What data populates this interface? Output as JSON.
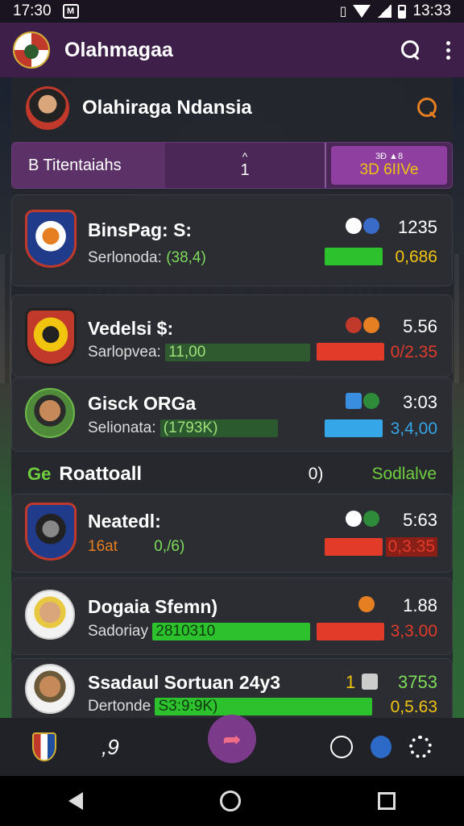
{
  "status": {
    "time_left": "17:30",
    "app_icon": "M",
    "time_right": "13:33"
  },
  "appbar": {
    "title": "Olahmagaa"
  },
  "org": {
    "name": "Olahiraga Ndansia"
  },
  "tabs": {
    "tab1": "B Titentaiahs",
    "tab2_caret": "^",
    "tab2": "1",
    "tab3_small": "3Ð ▲8",
    "tab3_big": "3D 6IIVe"
  },
  "cards": [
    {
      "name": "BinsPag: S:",
      "sub_label": "Serlonoda:",
      "sub_value": "(38,4)",
      "number": "1235",
      "value": "0,686",
      "bar_color": "#2ec12e",
      "value_color": "#f1c40f"
    },
    {
      "name": "Vedelsi $:",
      "sub_label": "Sarlopvea:",
      "sub_value": "11,00",
      "number": "5.56",
      "value": "0/2.35",
      "bar_color": "#e23b2a",
      "value_color": "#e23b2a"
    },
    {
      "name": "Gisck ORGa",
      "sub_label": "Selionata:",
      "sub_value": "(1793K)",
      "number": "3:03",
      "value": "3,4,00",
      "bar_color": "#35a6e8",
      "value_color": "#35a6e8"
    }
  ],
  "section": {
    "icon_text": "Ge",
    "label": "Roattoall",
    "mid": "0)",
    "right": "Sodlalve"
  },
  "cards2": [
    {
      "name": "Neatedl:",
      "sub_label": "16at",
      "sub_value": "0,/6)",
      "number": "5:63",
      "value": "0,3.35",
      "bar_color": "#e23b2a",
      "value_color": "#e23b2a"
    },
    {
      "name": "Dogaia Sfemn)",
      "sub_label": "Sadoriay",
      "sub_value": "2810310",
      "number": "1.88",
      "value": "3,3.00",
      "bar_color": "#e23b2a",
      "value_color": "#e23b2a"
    },
    {
      "name": "Ssadaul Sortuan 24y3",
      "sub_label": "Dertonde",
      "sub_value": "S3:9:9K)",
      "number": "3753",
      "number_prefix": "1",
      "value": "0,5.63",
      "bar_color": "#2ec12e",
      "value_color": "#f1c40f"
    }
  ],
  "bottomnav": {
    "num": ",9"
  }
}
